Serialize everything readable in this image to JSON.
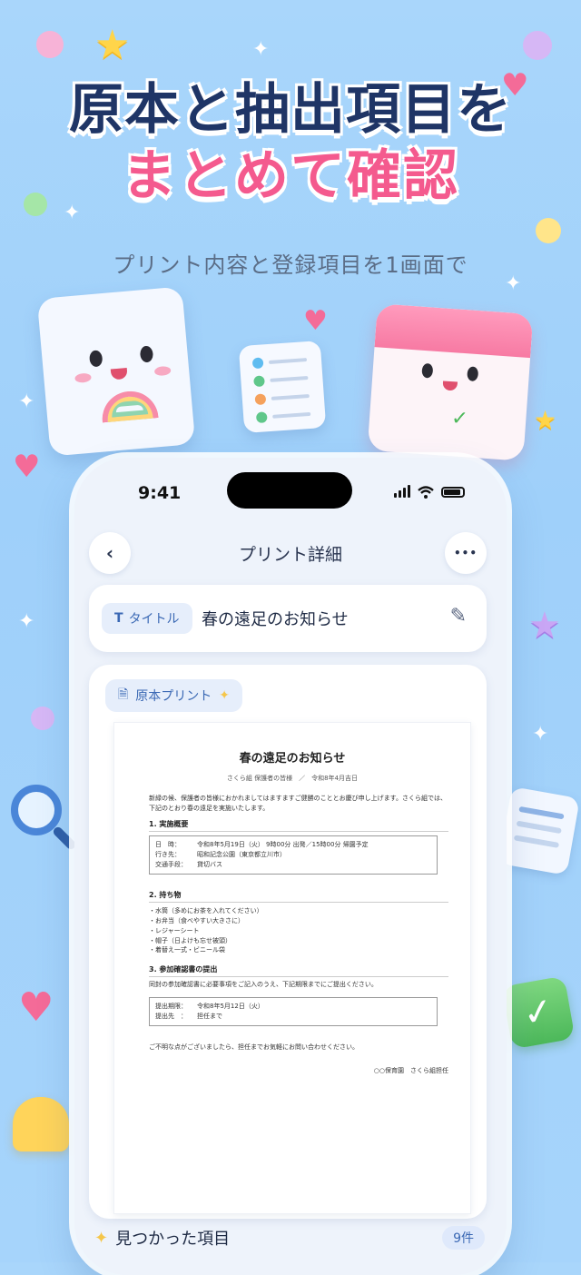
{
  "hero": {
    "title_line1": "原本と抽出項目を",
    "title_line2": "まとめて確認",
    "subtitle": "プリント内容と登録項目を1画面で"
  },
  "colors": {
    "background": "#a6d4fb",
    "title_navy": "#1f3566",
    "title_pink": "#f45a8e",
    "accent_blue": "#3a68b4"
  },
  "status_bar": {
    "time": "9:41"
  },
  "nav": {
    "back_icon": "chevron-left-icon",
    "back_glyph": "‹",
    "title": "プリント詳細",
    "more_icon": "more-horizontal-icon",
    "more_glyph": "•••"
  },
  "title_field": {
    "chip_icon": "T",
    "chip_label": "タイトル",
    "value": "春の遠足のお知らせ",
    "edit_icon": "pencil-icon"
  },
  "original": {
    "chip_label": "原本プリント",
    "chip_icon": "document-icon"
  },
  "print": {
    "title": "春の遠足のお知らせ",
    "meta": "さくら組 保護者の皆様　／　令和8年4月吉日",
    "intro": "新緑の候、保護者の皆様におかれましてはますますご健勝のこととお慶び申し上げます。さくら組では、下記のとおり春の遠足を実施いたします。",
    "section1": "1. 実施概要",
    "details": [
      {
        "label": "日　時：",
        "value": "令和8年5月19日（火） 9時00分 出発／15時00分 帰園予定"
      },
      {
        "label": "行き先：",
        "value": "昭和記念公園（東京都立川市）"
      },
      {
        "label": "交通手段：",
        "value": "貸切バス"
      }
    ],
    "section2": "2. 持ち物",
    "items": [
      "・水筒（多めにお茶を入れてください）",
      "・お弁当（食べやすい大きさに）",
      "・レジャーシート",
      "・帽子（日よけも忘せ被頭）",
      "・着替え一式・ビニール袋"
    ],
    "section3": "3. 参加確認書の提出",
    "submit_note": "同封の参加確認書に必要事項をご記入のうえ、下記期限までにご提出ください。",
    "submit": [
      {
        "label": "提出期限：",
        "value": "令和8年5月12日（火）"
      },
      {
        "label": "提出先　：",
        "value": "担任まで"
      }
    ],
    "closing": "ご不明な点がございましたら、担任までお気軽にお問い合わせください。",
    "signature": "○○保育園　さくら組担任"
  },
  "found": {
    "label": "見つかった項目",
    "count": "9件"
  }
}
